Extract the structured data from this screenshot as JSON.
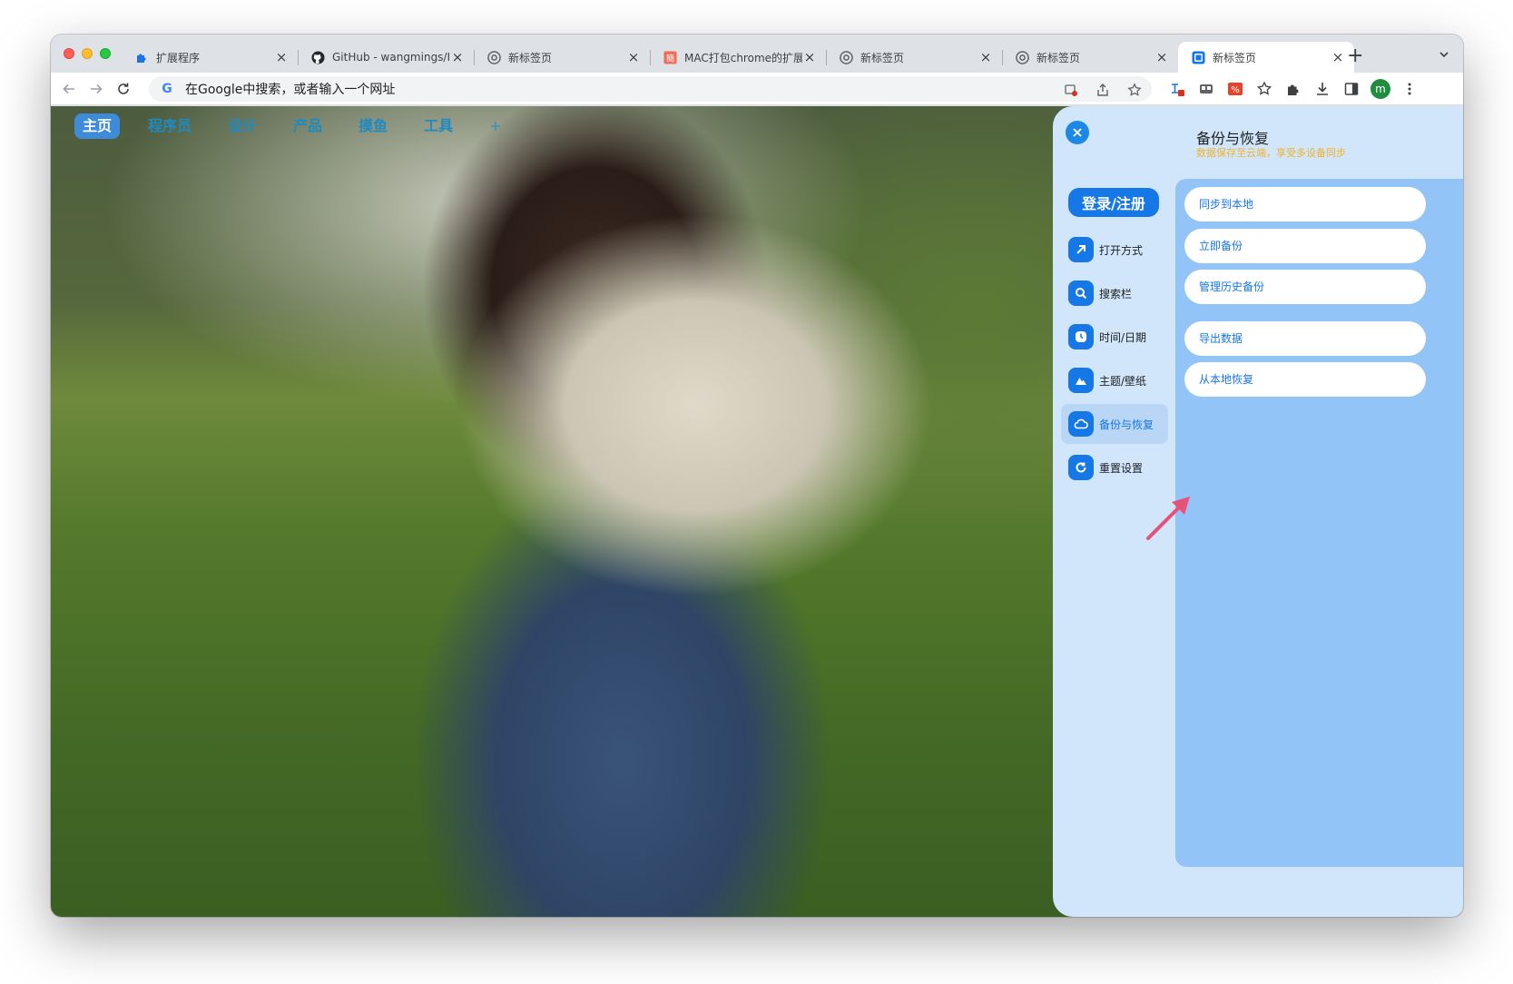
{
  "browser": {
    "tabs": [
      {
        "title": "扩展程序",
        "favicon": "puzzle-icon",
        "active": false
      },
      {
        "title": "GitHub - wangmings/IT",
        "favicon": "github-icon",
        "active": false
      },
      {
        "title": "新标签页",
        "favicon": "chrome-icon",
        "active": false
      },
      {
        "title": "MAC打包chrome的扩展",
        "favicon": "jianshu-icon",
        "active": false
      },
      {
        "title": "新标签页",
        "favicon": "chrome-icon",
        "active": false
      },
      {
        "title": "新标签页",
        "favicon": "chrome-icon",
        "active": false
      },
      {
        "title": "新标签页",
        "favicon": "extension-newtab-icon",
        "active": true
      }
    ],
    "omnibox_placeholder": "在Google中搜索，或者输入一个网址",
    "profile_initial": "m"
  },
  "page": {
    "topnav": [
      {
        "label": "主页",
        "active": true
      },
      {
        "label": "程序员",
        "active": false
      },
      {
        "label": "设计",
        "active": false
      },
      {
        "label": "产品",
        "active": false
      },
      {
        "label": "摸鱼",
        "active": false
      },
      {
        "label": "工具",
        "active": false
      },
      {
        "label": "+",
        "active": false
      }
    ]
  },
  "panel": {
    "title": "备份与恢复",
    "subtitle": "数据保存至云端，享受多设备同步",
    "login_label": "登录/注册",
    "menu": [
      {
        "label": "打开方式",
        "icon": "arrow-up-right-icon",
        "active": false
      },
      {
        "label": "搜索栏",
        "icon": "search-icon",
        "active": false
      },
      {
        "label": "时间/日期",
        "icon": "clock-icon",
        "active": false
      },
      {
        "label": "主题/壁纸",
        "icon": "mountain-icon",
        "active": false
      },
      {
        "label": "备份与恢复",
        "icon": "cloud-icon",
        "active": true
      },
      {
        "label": "重置设置",
        "icon": "reset-icon",
        "active": false
      }
    ],
    "actions": [
      {
        "label": "同步到本地"
      },
      {
        "label": "立即备份"
      },
      {
        "label": "管理历史备份"
      },
      {
        "label": "导出数据"
      },
      {
        "label": "从本地恢复"
      }
    ],
    "colors": {
      "accent": "#1677e6",
      "panel_bg": "#d1e5fb",
      "action_area_bg": "#93c4f8",
      "subtitle": "#f0b429",
      "arrow": "#e8527a"
    }
  }
}
